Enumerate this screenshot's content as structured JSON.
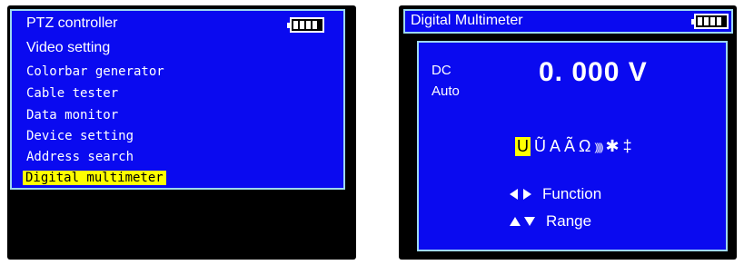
{
  "left_screen": {
    "menu": [
      {
        "label": "PTZ controller",
        "selected": false
      },
      {
        "label": "Video setting",
        "selected": false
      },
      {
        "label": "Colorbar generator",
        "selected": false
      },
      {
        "label": "Cable tester",
        "selected": false
      },
      {
        "label": "Data monitor",
        "selected": false
      },
      {
        "label": "Device setting",
        "selected": false
      },
      {
        "label": "Address search",
        "selected": false
      },
      {
        "label": "Digital multimeter",
        "selected": true
      }
    ]
  },
  "right_screen": {
    "title": "Digital Multimeter",
    "mode": "DC",
    "range_mode": "Auto",
    "reading": "0. 000 V",
    "mode_icons": [
      "U",
      "Ũ",
      "A",
      "Ã",
      "Ω",
      "))))",
      "✱",
      "‡"
    ],
    "mode_icon_names": [
      "dc-voltage-icon",
      "ac-voltage-icon",
      "dc-current-icon",
      "ac-current-icon",
      "ohm-icon",
      "continuity-icon",
      "diode-icon",
      "capacitor-icon"
    ],
    "selected_mode_index": 0,
    "hint_function": "Function",
    "hint_range": "Range"
  },
  "colors": {
    "screen_blue": "#0a0af0",
    "border": "#9ed8f0",
    "highlight": "#ffff00"
  }
}
